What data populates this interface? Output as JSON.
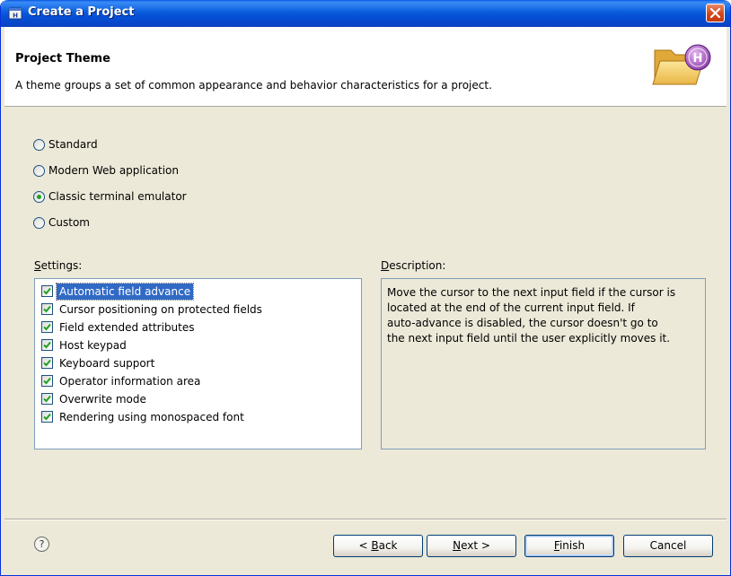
{
  "window": {
    "title": "Create a Project"
  },
  "banner": {
    "title": "Project Theme",
    "description": "A theme groups a set of common appearance and behavior characteristics for a project."
  },
  "theme_options": [
    {
      "label": "Standard",
      "selected": false
    },
    {
      "label": "Modern Web application",
      "selected": false
    },
    {
      "label": "Classic terminal emulator",
      "selected": true
    },
    {
      "label": "Custom",
      "selected": false
    }
  ],
  "settings": {
    "label_first": "S",
    "label_rest": "ettings:",
    "items": [
      {
        "label": "Automatic field advance",
        "checked": true,
        "selected": true
      },
      {
        "label": "Cursor positioning on protected fields",
        "checked": true,
        "selected": false
      },
      {
        "label": "Field extended attributes",
        "checked": true,
        "selected": false
      },
      {
        "label": "Host keypad",
        "checked": true,
        "selected": false
      },
      {
        "label": "Keyboard support",
        "checked": true,
        "selected": false
      },
      {
        "label": "Operator information area",
        "checked": true,
        "selected": false
      },
      {
        "label": "Overwrite mode",
        "checked": true,
        "selected": false
      },
      {
        "label": "Rendering using monospaced font",
        "checked": true,
        "selected": false
      }
    ]
  },
  "description": {
    "label_first": "D",
    "label_rest": "escription:",
    "text_lines": [
      "Move the cursor to the next input field if the cursor is",
      "located at the end of the current input field. If",
      "auto-advance is disabled, the cursor doesn't go to",
      "the next input field until the user explicitly moves it."
    ]
  },
  "footer": {
    "help_glyph": "?",
    "back": {
      "pre": "< ",
      "accel": "B",
      "post": "ack"
    },
    "next": {
      "pre": "",
      "accel": "N",
      "post": "ext >"
    },
    "finish": {
      "pre": "",
      "accel": "F",
      "post": "inish"
    },
    "cancel_label": "Cancel"
  },
  "colors": {
    "title_bar": "#0a5ddc",
    "dialog_bg": "#ece9d8",
    "selection": "#316ac5",
    "check": "#21a121"
  }
}
